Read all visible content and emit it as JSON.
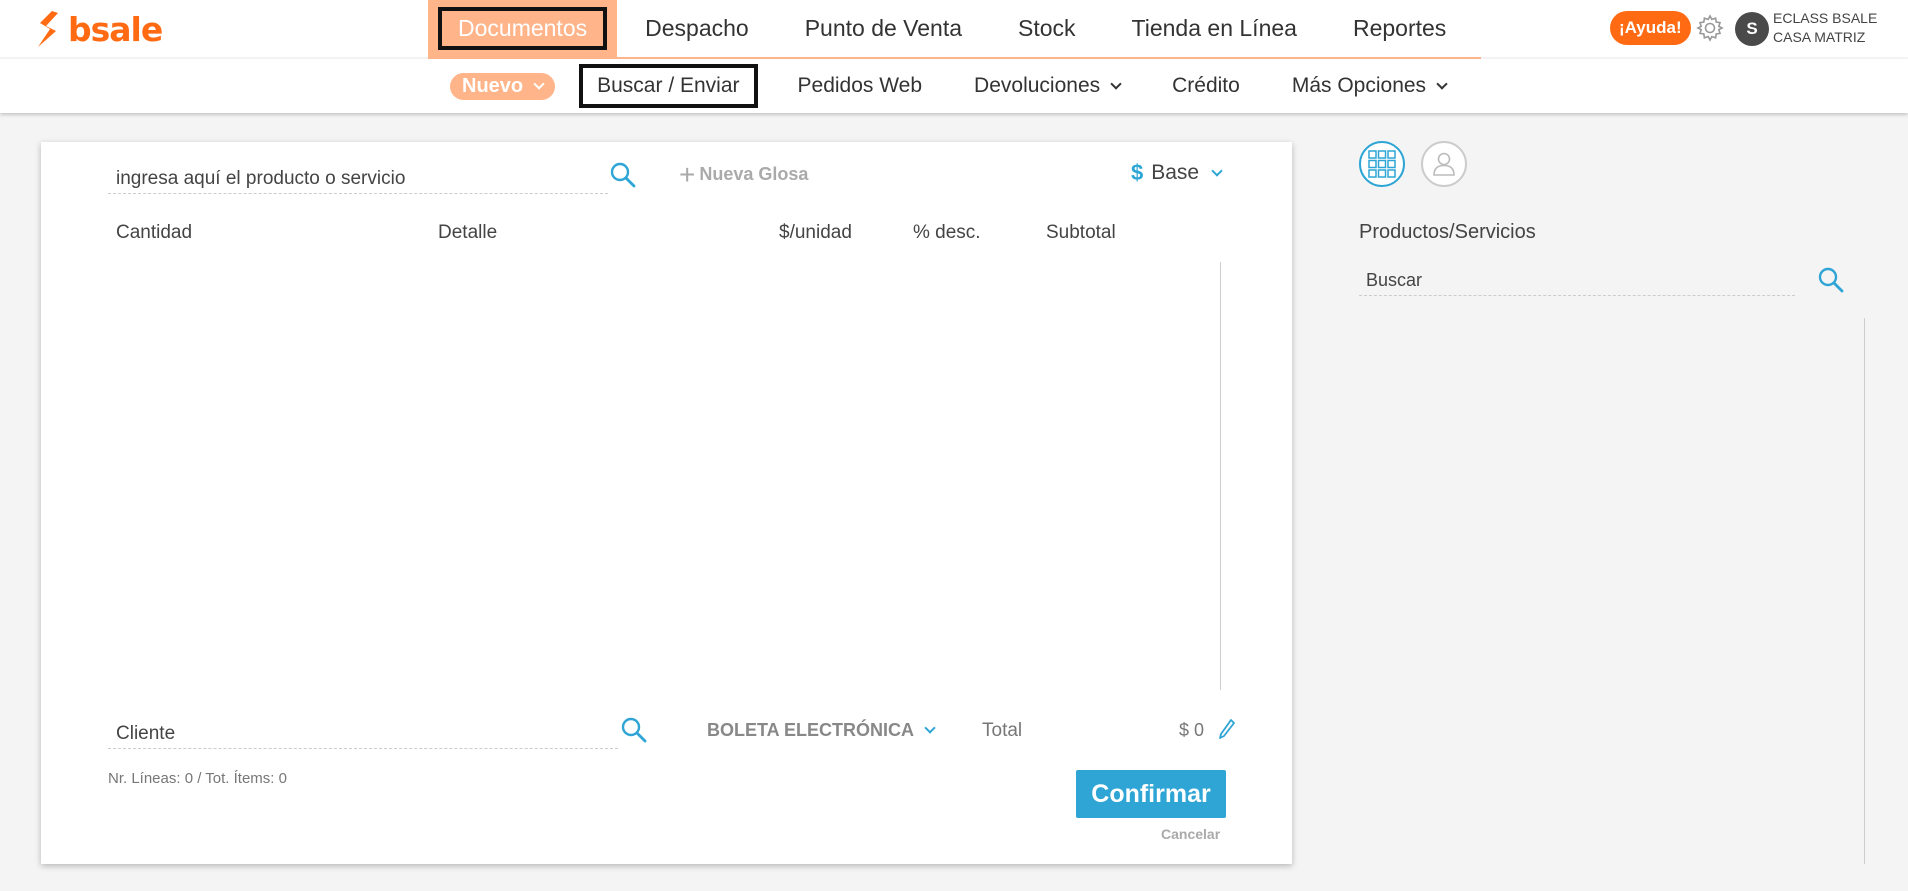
{
  "brand": {
    "name": "bsale",
    "color": "#ff6a13"
  },
  "main_nav": {
    "items": [
      {
        "label": "Documentos",
        "active": true
      },
      {
        "label": "Despacho",
        "active": false
      },
      {
        "label": "Punto de Venta",
        "active": false
      },
      {
        "label": "Stock",
        "active": false
      },
      {
        "label": "Tienda en Línea",
        "active": false
      },
      {
        "label": "Reportes",
        "active": false
      }
    ]
  },
  "header": {
    "help_label": "¡Ayuda!",
    "user_initial": "S",
    "user_name": "ECLASS BSALE",
    "user_branch": "CASA MATRIZ"
  },
  "sub_nav": {
    "items": [
      {
        "label": "Nuevo",
        "dropdown": true
      },
      {
        "label": "Buscar / Enviar",
        "dropdown": false
      },
      {
        "label": "Pedidos Web",
        "dropdown": false
      },
      {
        "label": "Devoluciones",
        "dropdown": true
      },
      {
        "label": "Crédito",
        "dropdown": false
      },
      {
        "label": "Más Opciones",
        "dropdown": true
      }
    ]
  },
  "document": {
    "product_search_placeholder": "ingresa aquí el producto o servicio",
    "new_gloss_label": "Nueva Glosa",
    "price_list_symbol": "$",
    "price_list_label": "Base",
    "columns": [
      "Cantidad",
      "Detalle",
      "$/unidad",
      "% desc.",
      "Subtotal"
    ],
    "client_placeholder": "Cliente",
    "document_type": "BOLETA ELECTRÓNICA",
    "total_label": "Total",
    "total_value": "$ 0",
    "stats": "Nr. Líneas: 0 / Tot. Ítems: 0",
    "confirm_label": "Confirmar",
    "cancel_label": "Cancelar"
  },
  "side_panel": {
    "title": "Productos/Servicios",
    "search_placeholder": "Buscar"
  },
  "colors": {
    "accent": "#2ea5d5",
    "nav_active": "#ffb489"
  }
}
